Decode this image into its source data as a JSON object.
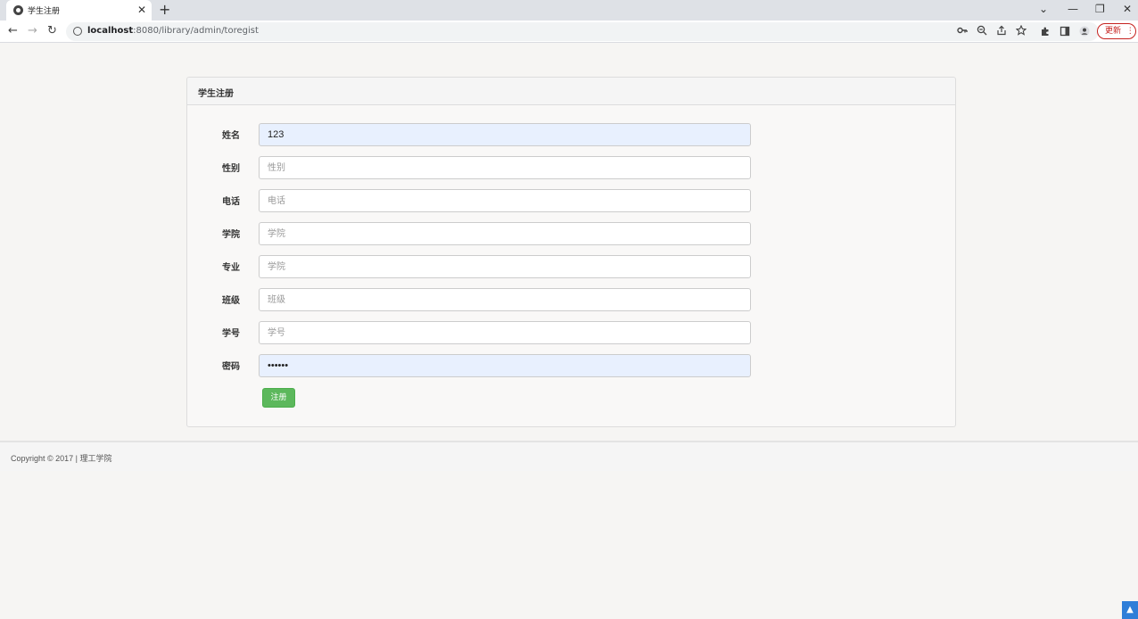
{
  "browser": {
    "tab_title": "学生注册",
    "tab_close": "✕",
    "new_tab": "+",
    "url_host": "localhost",
    "url_path": ":8080/library/admin/toregist",
    "update_label": "更新",
    "update_menu": "⋮",
    "window_controls": {
      "dropdown": "⌄",
      "minimize": "—",
      "restore": "❐",
      "close": "✕"
    },
    "nav": {
      "back": "←",
      "forward": "→",
      "reload": "↻"
    },
    "omnibox_icons": [
      "key-icon",
      "zoom-icon",
      "share-icon",
      "star-icon",
      "extensions-icon",
      "sidepanel-icon",
      "profile-icon"
    ]
  },
  "panel": {
    "heading": "学生注册"
  },
  "form": {
    "fields": [
      {
        "label": "姓名",
        "value": "123",
        "placeholder": ""
      },
      {
        "label": "性别",
        "value": "",
        "placeholder": "性别"
      },
      {
        "label": "电话",
        "value": "",
        "placeholder": "电话"
      },
      {
        "label": "学院",
        "value": "",
        "placeholder": "学院"
      },
      {
        "label": "专业",
        "value": "",
        "placeholder": "学院"
      },
      {
        "label": "班级",
        "value": "",
        "placeholder": "班级"
      },
      {
        "label": "学号",
        "value": "",
        "placeholder": "学号"
      },
      {
        "label": "密码",
        "value": "••••••",
        "placeholder": ""
      }
    ],
    "submit_label": "注册"
  },
  "footer": {
    "text": "Copyright © 2017 | 理工学院"
  },
  "colors": {
    "submit_button": "#5cb85c",
    "autofill_background": "#e8f0fe",
    "page_background": "#f6f5f3"
  }
}
